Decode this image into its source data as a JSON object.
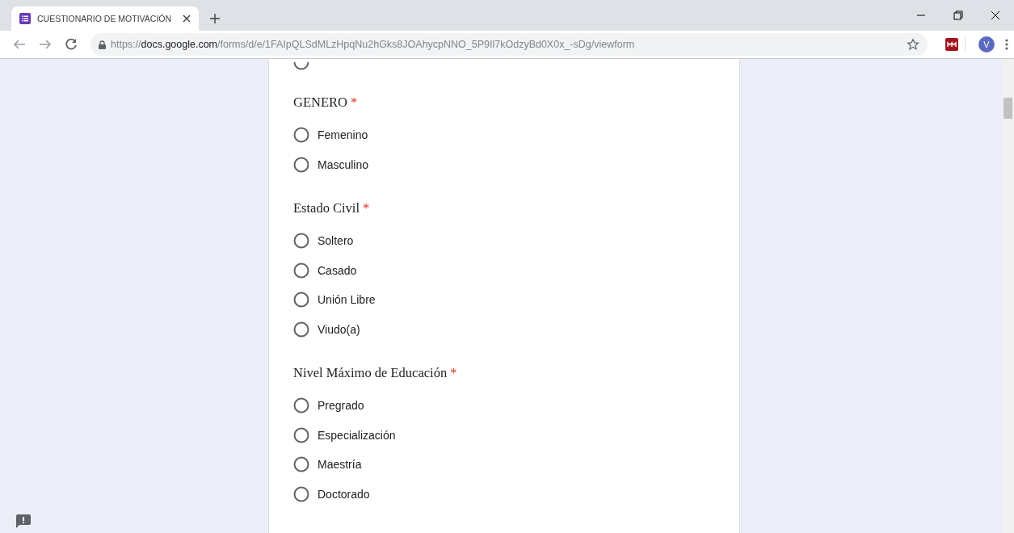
{
  "tab": {
    "title": "CUESTIONARIO DE MOTIVACIÓN",
    "selected": true
  },
  "address": {
    "scheme": "https://",
    "host": "docs.google.com",
    "path": "/forms/d/e/1FAIpQLSdMLzHpqNu2hGks8JOAhycpNNO_5P9Il7kOdzyBd0X0x_-sDg/viewform"
  },
  "profile": {
    "initial": "V"
  },
  "partial_option": {
    "selected": false
  },
  "questions": [
    {
      "title": "GENERO",
      "required_mark": "*",
      "options": [
        {
          "label": "Femenino",
          "selected": false
        },
        {
          "label": "Masculino",
          "selected": false
        }
      ]
    },
    {
      "title": "Estado Civil",
      "required_mark": "*",
      "options": [
        {
          "label": "Soltero",
          "selected": false
        },
        {
          "label": "Casado",
          "selected": false
        },
        {
          "label": "Unión Libre",
          "selected": false
        },
        {
          "label": "Viudo(a)",
          "selected": false
        }
      ]
    },
    {
      "title": "Nivel Máximo de Educación",
      "required_mark": "*",
      "options": [
        {
          "label": "Pregrado",
          "selected": false
        },
        {
          "label": "Especialización",
          "selected": false
        },
        {
          "label": "Maestría",
          "selected": false
        },
        {
          "label": "Doctorado",
          "selected": false
        }
      ]
    }
  ]
}
